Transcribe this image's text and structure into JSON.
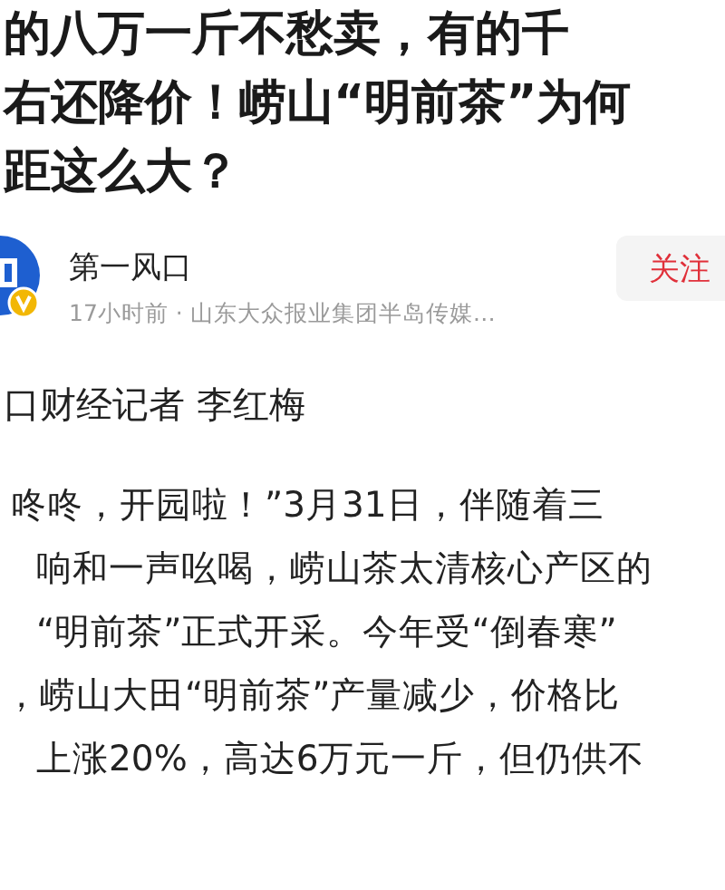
{
  "headline": {
    "lines": [
      "的八万一斤不愁卖，有的千",
      "右还降价！崂山“明前茶”为何",
      "距这么大？"
    ]
  },
  "author": {
    "name": "第一风口",
    "meta": "17小时前 · 山东大众报业集团半岛传媒…",
    "verified": true,
    "follow_label": "关注"
  },
  "article": {
    "byline": "口财经记者 李红梅",
    "lines": [
      "咚咚，开园啦！”3月31日，伴随着三",
      "响和一声吆喝，崂山茶太清核心产区的",
      "“明前茶”正式开采。今年受“倒春寒”",
      "，崂山大田“明前茶”产量减少，价格比",
      "上涨20%，高达6万元一斤，但仍供不"
    ]
  }
}
